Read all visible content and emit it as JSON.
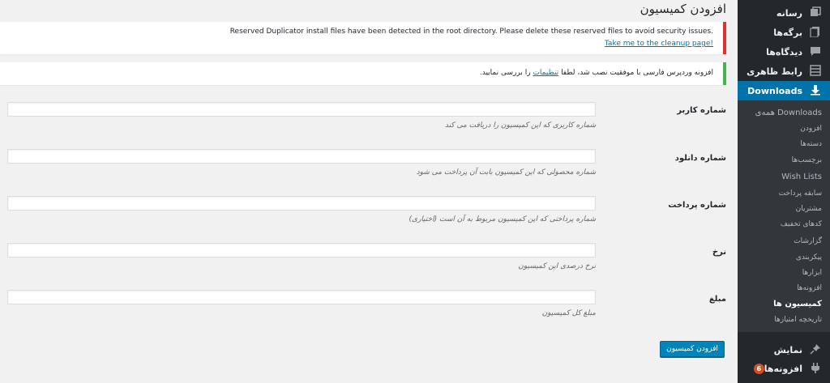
{
  "page": {
    "title": "افزودن کمیسیون"
  },
  "notices": {
    "duplicator_text": "Reserved Duplicator install files have been detected in the root directory. Please delete these reserved files to avoid security issues.",
    "duplicator_link": "Take me to the cleanup page!",
    "persian_before": "افزونه وردپرس فارسی با موفقیت نصب شد، لطفا",
    "persian_link": "تنظیمات",
    "persian_after": "را بررسی نمایید."
  },
  "form": {
    "fields": [
      {
        "label": "شماره کاربر",
        "description": "شماره کاربری که این کمیسیون را دریافت می کند",
        "value": ""
      },
      {
        "label": "شماره دانلود",
        "description": "شماره محصولی که این کمیسیون بابت آن پرداخت می شود",
        "value": ""
      },
      {
        "label": "شماره پرداخت",
        "description": "شماره پرداختی که این کمیسیون مربوط به آن است (اختیاری)",
        "value": ""
      },
      {
        "label": "نرخ",
        "description": "نرخ درصدی این کمیسیون",
        "value": ""
      },
      {
        "label": "مبلغ",
        "description": "مبلغ کل کمیسیون",
        "value": ""
      }
    ],
    "submit_label": "افزودن کمیسیون"
  },
  "sidebar": {
    "items": [
      {
        "label": "رسانه",
        "icon": "media-icon"
      },
      {
        "label": "برگه‌ها",
        "icon": "pages-icon"
      },
      {
        "label": "دیدگاه‌ها",
        "icon": "comments-icon"
      },
      {
        "label": "رابط ظاهری",
        "icon": "appearance-icon"
      },
      {
        "label": "Downloads",
        "icon": "download-icon"
      }
    ],
    "submenu": [
      "همه‌ی Downloads",
      "افزودن",
      "دسته‌ها",
      "برچسب‌ها",
      "Wish Lists",
      "سابقه پرداخت",
      "مشتریان",
      "کدهای تخفیف",
      "گزارشات",
      "پیکربندی",
      "ابزارها",
      "افزونه‌ها",
      "کمیسیون ها",
      "تاریخچه امتیازها"
    ],
    "bottom_items": [
      {
        "label": "نمایش",
        "icon": "pin-icon"
      },
      {
        "label": "افزونه‌ها",
        "icon": "plugins-icon",
        "badge": "6"
      }
    ]
  },
  "colors": {
    "accent": "#0073aa",
    "sidebar_bg": "#23282d",
    "submenu_bg": "#32373c",
    "error": "#dc3232",
    "success": "#46b450",
    "badge": "#d54e21"
  }
}
